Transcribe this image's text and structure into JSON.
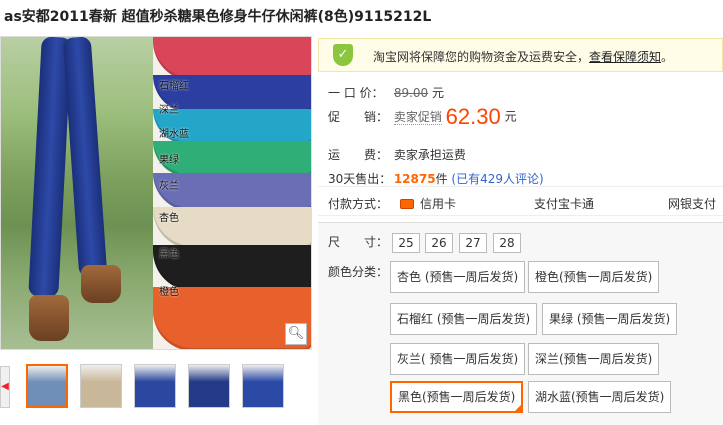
{
  "title": "as安都2011春新 超值秒杀糖果色修身牛仔休闲裤(8色)9115212L",
  "gallery": {
    "swatches": [
      {
        "label": "石榴红",
        "color": "#d9465a"
      },
      {
        "label": "深兰",
        "color": "#2c3fa0"
      },
      {
        "label": "湖水蓝",
        "color": "#23a6c8"
      },
      {
        "label": "果绿",
        "color": "#2fae78"
      },
      {
        "label": "灰兰",
        "color": "#6a6fb5"
      },
      {
        "label": "杏色",
        "color": "#e6dcc6"
      },
      {
        "label": "黑色",
        "color": "#1e1e1e"
      },
      {
        "label": "橙色",
        "color": "#e8612c"
      }
    ],
    "zoom_icon": "magnifier-icon",
    "thumbnails": [
      "#6f8fb8",
      "#c9b79a",
      "#2b47a0",
      "#223a88",
      "#2b4aa6"
    ]
  },
  "guarantee": {
    "icon": "shield-icon",
    "text": "淘宝网将保障您的购物资金及运费安全，",
    "link": "查看保障须知",
    "end": "。"
  },
  "price": {
    "label": "一 口 价：",
    "value": "89.00",
    "unit": "元"
  },
  "promo": {
    "label": "促　　销：",
    "tag": "卖家促销",
    "value": "62.30",
    "unit": "元"
  },
  "shipping": {
    "label": "运　　费：",
    "value": "卖家承担运费"
  },
  "sales": {
    "label": "30天售出：",
    "count": "12875",
    "unit": "件",
    "reviews": "(已有429人评论)"
  },
  "payment": {
    "label": "付款方式：",
    "methods": [
      "信用卡",
      "支付宝卡通",
      "网银支付"
    ]
  },
  "size": {
    "label": "尺　　寸：",
    "options": [
      "25",
      "26",
      "27",
      "28"
    ]
  },
  "color": {
    "label": "颜色分类：",
    "options": [
      "杏色 (预售一周后发货)",
      "橙色(预售一周后发货)",
      "石榴红 (预售一周后发货)",
      "果绿 (预售一周后发货)",
      "灰兰( 预售一周后发货)",
      "深兰(预售一周后发货)",
      "黑色(预售一周后发货)",
      "湖水蓝(预售一周后发货)"
    ],
    "selected_index": 6,
    "accent": "#ff6600"
  }
}
